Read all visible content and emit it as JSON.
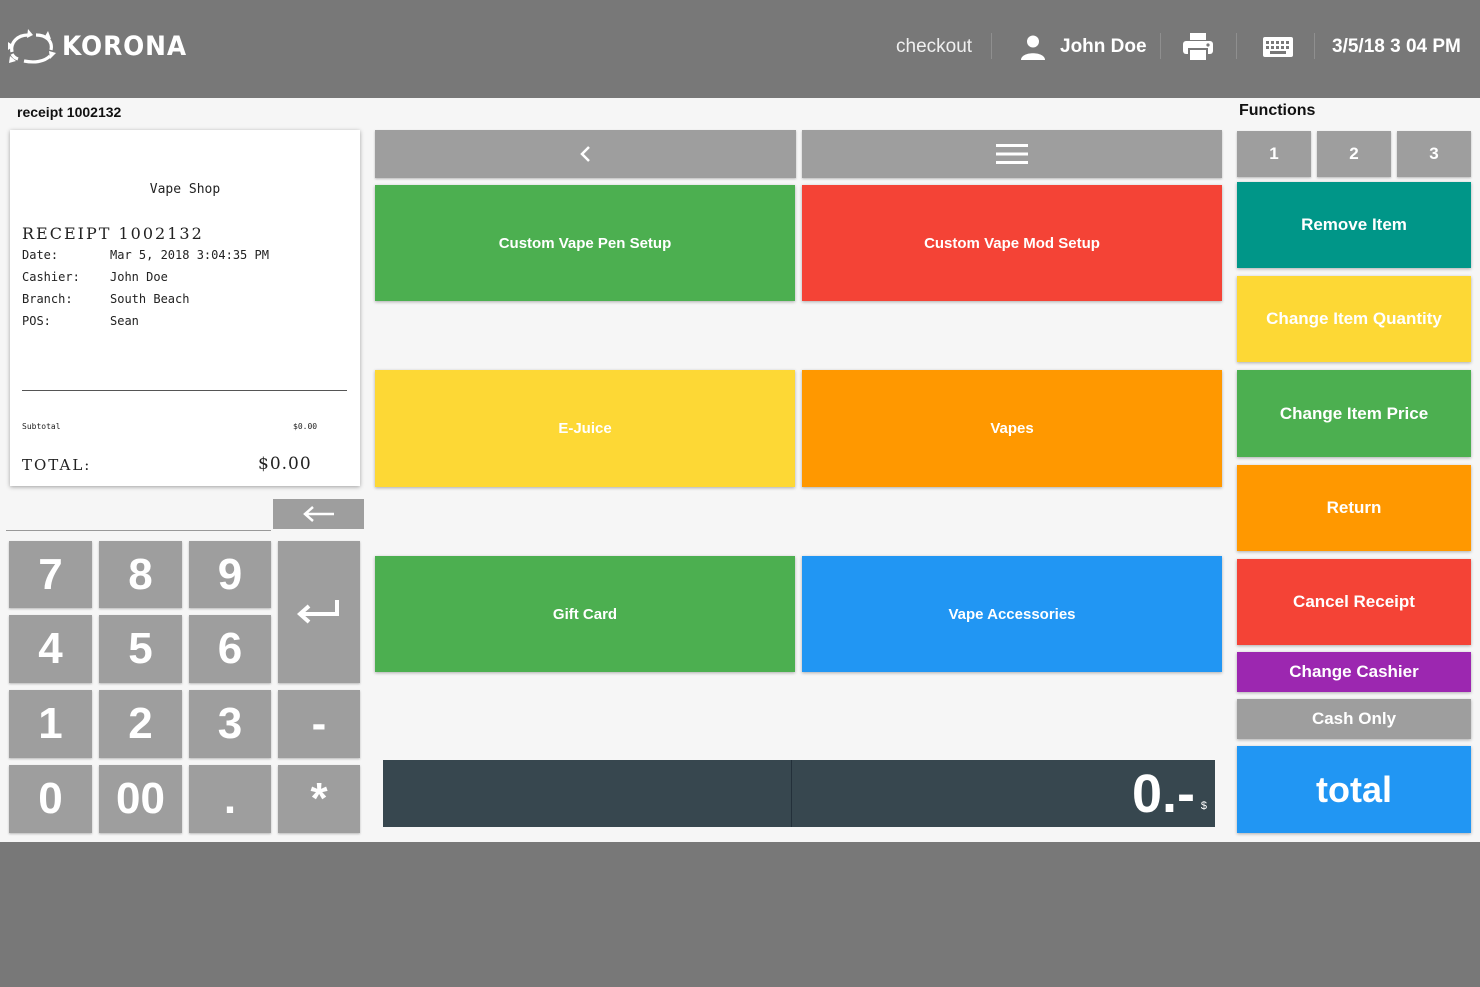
{
  "header": {
    "brand": "KORONA",
    "checkout": "checkout",
    "user": "John Doe",
    "datetime": "3/5/18 3 04 PM"
  },
  "receipt_panel": {
    "label": "receipt 1002132",
    "shop": "Vape Shop",
    "title": "RECEIPT  1002132",
    "rows": [
      {
        "k": "Date:",
        "v": "Mar 5, 2018 3:04:35 PM"
      },
      {
        "k": "Cashier:",
        "v": "John Doe"
      },
      {
        "k": "Branch:",
        "v": "South Beach"
      },
      {
        "k": "POS:",
        "v": "Sean"
      }
    ],
    "subtotal_label": "Subtotal",
    "subtotal_value": "$0.00",
    "total_label": "TOTAL:",
    "total_value": "$0.00"
  },
  "keypad": {
    "backspace": "←",
    "enter": "↵",
    "keys": [
      "7",
      "8",
      "9",
      "4",
      "5",
      "6",
      "1",
      "2",
      "3",
      "-",
      "0",
      "00",
      ".",
      "*"
    ]
  },
  "products": {
    "tiles": [
      {
        "label": "Custom Vape Pen Setup",
        "color": "#4caf50"
      },
      {
        "label": "Custom Vape Mod Setup",
        "color": "#f44336"
      },
      {
        "label": "E-Juice",
        "color": "#fdd835"
      },
      {
        "label": "Vapes",
        "color": "#ff9800"
      },
      {
        "label": "Gift Card",
        "color": "#4caf50"
      },
      {
        "label": "Vape Accessories",
        "color": "#2196f3"
      }
    ]
  },
  "amount_display": {
    "value": "0.-",
    "currency": "$"
  },
  "functions": {
    "label": "Functions",
    "tabs": [
      "1",
      "2",
      "3"
    ],
    "buttons": [
      {
        "label": "Remove Item",
        "color": "#009688"
      },
      {
        "label": "Change Item Quantity",
        "color": "#fdd835"
      },
      {
        "label": "Change Item Price",
        "color": "#4caf50"
      },
      {
        "label": "Return",
        "color": "#ff9800"
      },
      {
        "label": "Cancel Receipt",
        "color": "#f44336"
      },
      {
        "label": "Change Cashier",
        "color": "#9c27b0"
      },
      {
        "label": "Cash Only",
        "color": "#9e9e9e"
      },
      {
        "label": "total",
        "color": "#2196f3"
      }
    ]
  }
}
